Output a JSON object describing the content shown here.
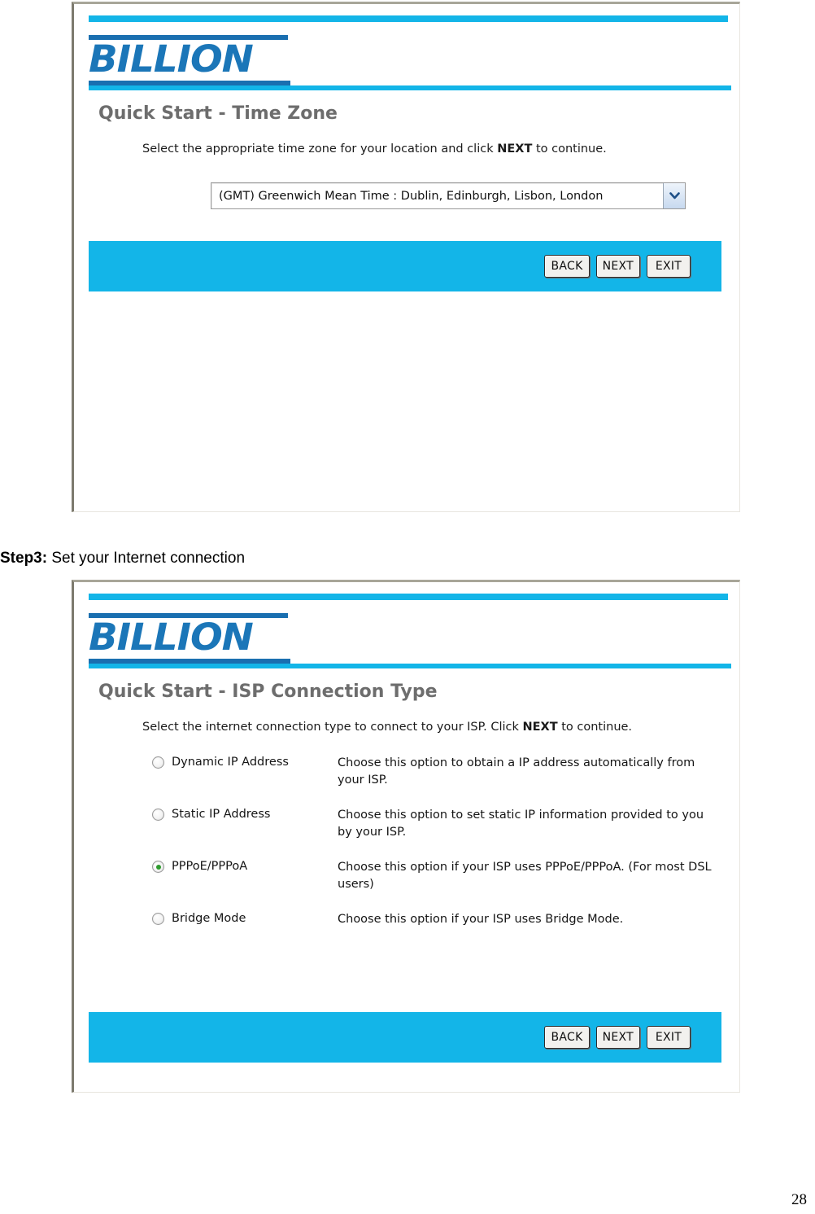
{
  "document": {
    "page_number": "28",
    "step_heading_prefix": "Step3:",
    "step_heading_text": " Set your Internet connection"
  },
  "colors": {
    "accent_cyan": "#13b5e8",
    "logo_blue": "#1b76b8",
    "logo_rule_dark": "#1a6fb0",
    "title_gray": "#6d6d6d",
    "radio_checked_green": "#2e9b2e"
  },
  "panels": [
    {
      "logo_text": "BILLION",
      "title": "Quick Start - Time Zone",
      "subtitle_before": "Select the appropriate time zone for your location and click ",
      "subtitle_strong": "NEXT",
      "subtitle_after": " to continue.",
      "timezone_select": {
        "selected_value": "(GMT) Greenwich Mean Time : Dublin, Edinburgh, Lisbon, London",
        "arrow_icon": "chevron-down-icon"
      },
      "buttons": {
        "back": "BACK",
        "next": "NEXT",
        "exit": "EXIT"
      }
    },
    {
      "logo_text": "BILLION",
      "title": "Quick Start - ISP Connection Type",
      "subtitle_before": "Select the internet connection type to connect to your ISP. Click ",
      "subtitle_strong": "NEXT",
      "subtitle_after": " to continue.",
      "connection_options": [
        {
          "label": "Dynamic IP Address",
          "description": "Choose this option to obtain a IP address automatically from your ISP.",
          "selected": false
        },
        {
          "label": "Static IP Address",
          "description": "Choose this option to set static IP information provided to you by your ISP.",
          "selected": false
        },
        {
          "label": "PPPoE/PPPoA",
          "description": "Choose this option if your ISP uses PPPoE/PPPoA. (For most DSL users)",
          "selected": true
        },
        {
          "label": "Bridge Mode",
          "description": "Choose this option if your ISP uses Bridge Mode.",
          "selected": false
        }
      ],
      "buttons": {
        "back": "BACK",
        "next": "NEXT",
        "exit": "EXIT"
      }
    }
  ]
}
